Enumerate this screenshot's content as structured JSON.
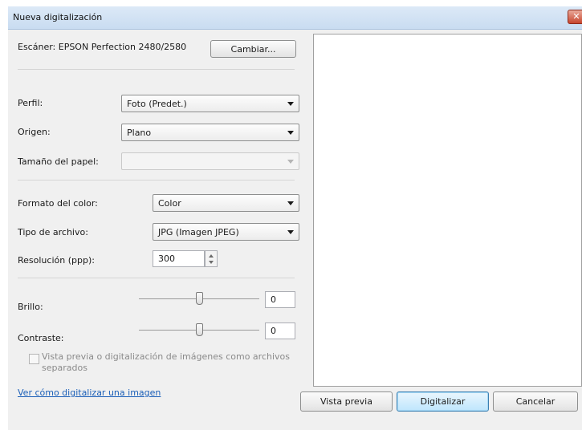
{
  "window": {
    "title": "Nueva digitalización",
    "close_glyph": "✕"
  },
  "scanner": {
    "label": "Escáner: EPSON Perfection 2480/2580",
    "change_button": "Cambiar..."
  },
  "profile": {
    "label": "Perfil:",
    "value": "Foto (Predet.)"
  },
  "source": {
    "label": "Origen:",
    "value": "Plano"
  },
  "paper_size": {
    "label": "Tamaño del papel:",
    "value": ""
  },
  "color_format": {
    "label": "Formato del color:",
    "value": "Color"
  },
  "file_type": {
    "label": "Tipo de archivo:",
    "value": "JPG (Imagen JPEG)"
  },
  "resolution": {
    "label": "Resolución (ppp):",
    "value": "300"
  },
  "brightness": {
    "label": "Brillo:",
    "value": "0",
    "slider_fraction": 0.5
  },
  "contrast": {
    "label": "Contraste:",
    "value": "0",
    "slider_fraction": 0.5
  },
  "separate_files": {
    "label_line1": "Vista previa o digitalización de imágenes como archivos",
    "label_line2": "separados",
    "checked": false
  },
  "help_link": "Ver cómo digitalizar una imagen",
  "buttons": {
    "preview": "Vista previa",
    "scan": "Digitalizar",
    "cancel": "Cancelar"
  }
}
